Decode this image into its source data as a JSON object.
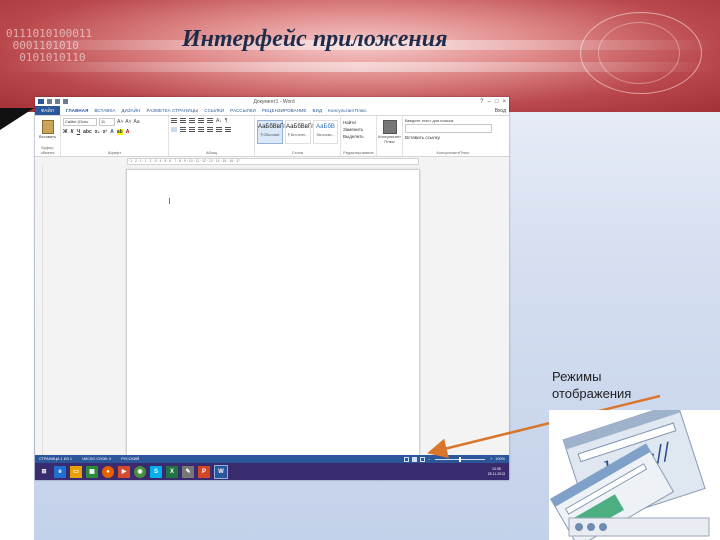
{
  "slide": {
    "title": "Интерфейс приложения",
    "callout": [
      "Режимы",
      "отображения"
    ]
  },
  "word": {
    "window_title": "Документ1 - Word",
    "tabs": [
      "ФАЙЛ",
      "ГЛАВНАЯ",
      "ВСТАВКА",
      "ДИЗАЙН",
      "РАЗМЕТКА СТРАНИЦЫ",
      "ССЫЛКИ",
      "РАССЫЛКИ",
      "РЕЦЕНЗИРОВАНИЕ",
      "ВИД",
      "КонсультантПлюс"
    ],
    "sign_in": "Вход",
    "groups": {
      "clipboard": "Буфер обмена",
      "font": "Шрифт",
      "paragraph": "Абзац",
      "styles": "Стили",
      "editing": "Редактирование",
      "konsultant": "КонсультантПлюс"
    },
    "paste_label": "Вставить",
    "font_name": "Calibri (Осно",
    "font_size": "11",
    "styles": [
      {
        "sample": "АаБбВвГг,",
        "name": "¶ Обычный"
      },
      {
        "sample": "АаБбВвГг,",
        "name": "¶ Без инте..."
      },
      {
        "sample": "АаБбВ",
        "name": "Заголово..."
      }
    ],
    "edit": {
      "find": "Найти",
      "replace": "Заменить",
      "select": "Выделить"
    },
    "konsultant_btn": "Консультант Плюс",
    "search_placeholder": "Введите текст для поиска:",
    "insert_link": "Вставить ссылку",
    "ruler_text": "· 1 · 2 · 1 · 1 · 2 · 3 · 4 · 5 · 6 · 7 · 8 · 9 · 10 · 11 · 12 · 13 · 14 · 15 · 16 · 17",
    "status": {
      "page": "СТРАНИЦА 1 ИЗ 1",
      "words": "ЧИСЛО СЛОВ: 0",
      "lang": "РУССКИЙ",
      "zoom": "100%"
    },
    "clock": {
      "time": "13:08",
      "date": "28.11.2013"
    },
    "taskbar_lang": "РУС"
  }
}
